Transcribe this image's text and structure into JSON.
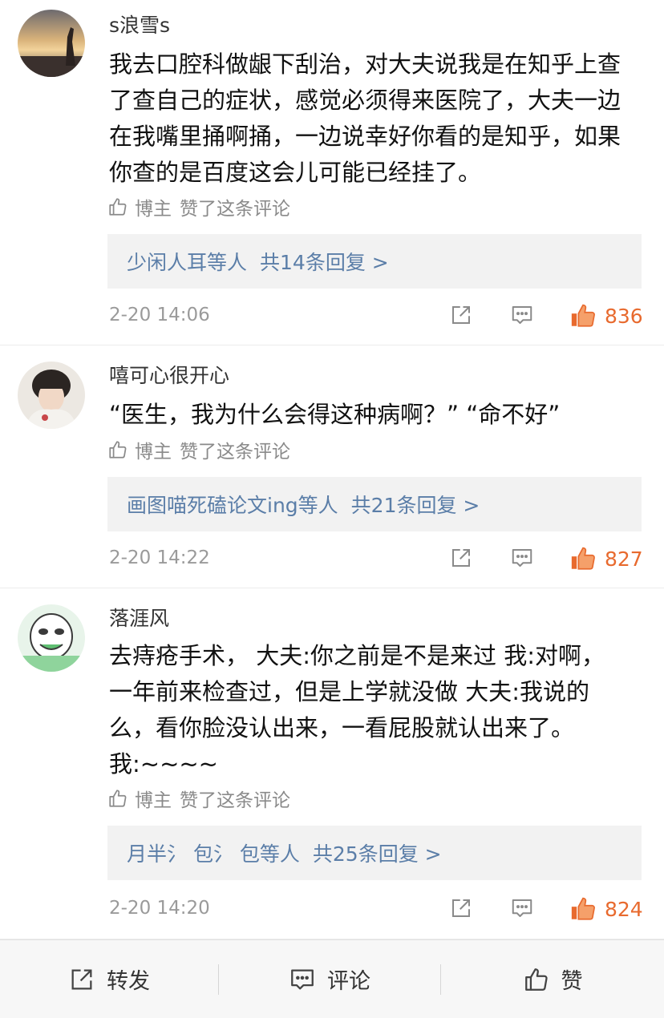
{
  "comments": [
    {
      "username": "s浪雪s",
      "body_lines": [
        "我去口腔科做龈下刮治，对大夫说我是在知乎上查",
        "了查自己的症状，感觉必须得来医院了，大夫一边",
        "在我嘴里捅啊捅，一边说幸好你看的是知乎，如果",
        "你查的是百度这会儿可能已经挂了。"
      ],
      "author_like": {
        "who": "博主",
        "text": "赞了这条评论"
      },
      "replies": {
        "names": "少闲人耳等人",
        "total": "共14条回复 >"
      },
      "timestamp": "2-20 14:06",
      "likes": "836"
    },
    {
      "username": "嘻可心很开心",
      "body_lines": [
        "“医生，我为什么会得这种病啊？” “命不好”"
      ],
      "author_like": {
        "who": "博主",
        "text": "赞了这条评论"
      },
      "replies": {
        "names": "画图喵死磕论文ing等人",
        "total": "共21条回复 >"
      },
      "timestamp": "2-20 14:22",
      "likes": "827"
    },
    {
      "username": "落涯风",
      "body_lines": [
        "去痔疮手术， 大夫:你之前是不是来过 我:对啊，",
        "一年前来检查过，但是上学就没做 大夫:我说的",
        "么，看你脸没认出来，一看屁股就认出来了。",
        "我:~~~~"
      ],
      "author_like": {
        "who": "博主",
        "text": "赞了这条评论"
      },
      "replies": {
        "names": "月半氵 包氵 包等人",
        "total": "共25条回复 >"
      },
      "timestamp": "2-20 14:20",
      "likes": "824"
    }
  ],
  "bottom_bar": {
    "repost": "转发",
    "comment": "评论",
    "like": "赞"
  },
  "colors": {
    "link_blue": "#5b7ea8",
    "like_orange": "#e86a2e",
    "muted_gray": "#9a9a9a",
    "reply_box_bg": "#f2f2f2"
  },
  "icons": {
    "author_like": "thumbs-up-outline-icon",
    "share": "share-icon",
    "comment": "comment-bubble-icon",
    "like": "thumbs-up-filled-icon"
  }
}
